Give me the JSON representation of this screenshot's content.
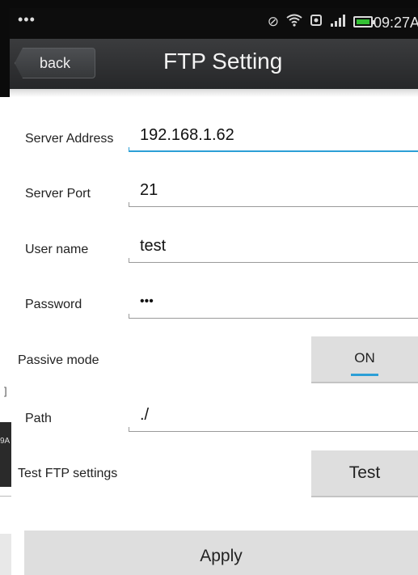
{
  "status_bar": {
    "dots": "•••",
    "time": "09:27A",
    "icons": [
      "mute-icon",
      "wifi-icon",
      "sim-icon",
      "signal-icon",
      "battery-icon"
    ]
  },
  "title_bar": {
    "back_label": "back",
    "title": "FTP Setting"
  },
  "form": {
    "server_address": {
      "label": "Server Address",
      "value": "192.168.1.62"
    },
    "server_port": {
      "label": "Server Port",
      "value": "21"
    },
    "user_name": {
      "label": "User name",
      "value": "test"
    },
    "password": {
      "label": "Password",
      "value": "•••"
    },
    "passive_mode": {
      "label": "Passive mode",
      "button": "ON"
    },
    "path": {
      "label": "Path",
      "value": "./"
    },
    "test_ftp": {
      "label": "Test FTP settings",
      "button": "Test"
    },
    "apply_label": "Apply"
  },
  "fragments": {
    "bracket": "]",
    "dark_text": "9A"
  },
  "colors": {
    "accent": "#2c9fd6",
    "titlebar": "#2e2f31",
    "button_bg": "#dedede"
  }
}
